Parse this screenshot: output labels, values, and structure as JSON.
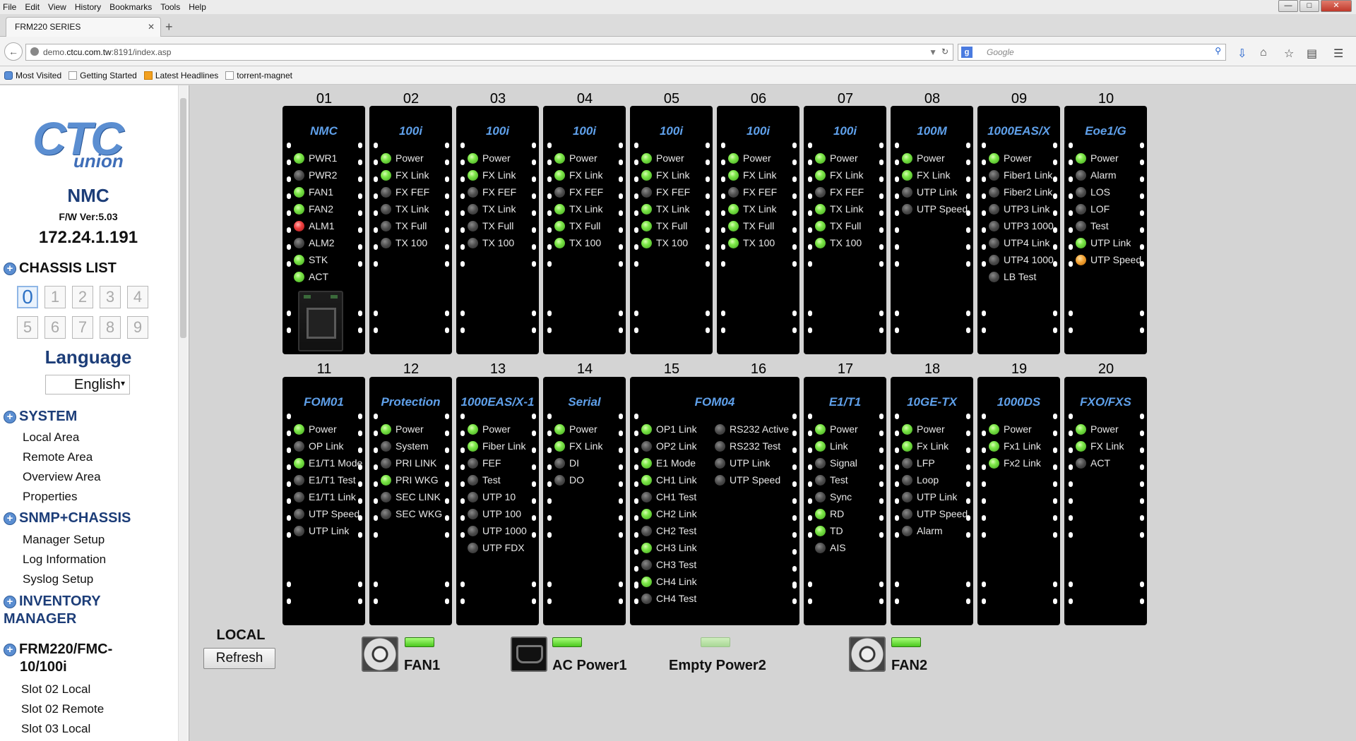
{
  "browser": {
    "menu": [
      "File",
      "Edit",
      "View",
      "History",
      "Bookmarks",
      "Tools",
      "Help"
    ],
    "tab_title": "FRM220 SERIES",
    "url_prefix": "demo.",
    "url_host": "ctcu.com.tw",
    "url_rest": ":8191/index.asp",
    "search_placeholder": "Google",
    "bookmarks": [
      "Most Visited",
      "Getting Started",
      "Latest Headlines",
      "torrent-magnet"
    ]
  },
  "sidebar": {
    "logo_main": "CTC",
    "logo_sub": "union",
    "device": "NMC",
    "firmware": "F/W Ver:5.03",
    "ip": "172.24.1.191",
    "chassis_list_label": "CHASSIS LIST",
    "chassis": [
      "0",
      "1",
      "2",
      "3",
      "4",
      "5",
      "6",
      "7",
      "8",
      "9"
    ],
    "chassis_active": 0,
    "language_label": "Language",
    "language_value": "English",
    "system_label": "SYSTEM",
    "system_items": [
      "Local Area",
      "Remote Area",
      "Overview Area",
      "Properties"
    ],
    "snmp_label": "SNMP+CHASSIS",
    "snmp_items": [
      "Manager Setup",
      "Log Information",
      "Syslog Setup"
    ],
    "inventory_label_1": "INVENTORY",
    "inventory_label_2": "MANAGER",
    "frm_label_1": "FRM220/FMC-",
    "frm_label_2": "10/100i",
    "frm_items": [
      "Slot 02 Local",
      "Slot 02 Remote",
      "Slot 03 Local"
    ]
  },
  "slots": [
    {
      "num": "01",
      "title": "NMC",
      "leds": [
        [
          "PWR1",
          "green"
        ],
        [
          "PWR2",
          "gray"
        ],
        [
          "FAN1",
          "green"
        ],
        [
          "FAN2",
          "green"
        ],
        [
          "ALM1",
          "red"
        ],
        [
          "ALM2",
          "gray"
        ],
        [
          "STK",
          "green"
        ],
        [
          "ACT",
          "green"
        ]
      ]
    },
    {
      "num": "02",
      "title": "100i",
      "leds": [
        [
          "Power",
          "green"
        ],
        [
          "FX Link",
          "green"
        ],
        [
          "FX FEF",
          "gray"
        ],
        [
          "TX Link",
          "gray"
        ],
        [
          "TX Full",
          "gray"
        ],
        [
          "TX 100",
          "gray"
        ]
      ]
    },
    {
      "num": "03",
      "title": "100i",
      "leds": [
        [
          "Power",
          "green"
        ],
        [
          "FX Link",
          "green"
        ],
        [
          "FX FEF",
          "gray"
        ],
        [
          "TX Link",
          "gray"
        ],
        [
          "TX Full",
          "gray"
        ],
        [
          "TX 100",
          "gray"
        ]
      ]
    },
    {
      "num": "04",
      "title": "100i",
      "leds": [
        [
          "Power",
          "green"
        ],
        [
          "FX Link",
          "green"
        ],
        [
          "FX FEF",
          "gray"
        ],
        [
          "TX Link",
          "green"
        ],
        [
          "TX Full",
          "green"
        ],
        [
          "TX 100",
          "green"
        ]
      ]
    },
    {
      "num": "05",
      "title": "100i",
      "leds": [
        [
          "Power",
          "green"
        ],
        [
          "FX Link",
          "green"
        ],
        [
          "FX FEF",
          "gray"
        ],
        [
          "TX Link",
          "green"
        ],
        [
          "TX Full",
          "green"
        ],
        [
          "TX 100",
          "green"
        ]
      ]
    },
    {
      "num": "06",
      "title": "100i",
      "leds": [
        [
          "Power",
          "green"
        ],
        [
          "FX Link",
          "green"
        ],
        [
          "FX FEF",
          "gray"
        ],
        [
          "TX Link",
          "green"
        ],
        [
          "TX Full",
          "green"
        ],
        [
          "TX 100",
          "green"
        ]
      ]
    },
    {
      "num": "07",
      "title": "100i",
      "leds": [
        [
          "Power",
          "green"
        ],
        [
          "FX Link",
          "green"
        ],
        [
          "FX FEF",
          "gray"
        ],
        [
          "TX Link",
          "green"
        ],
        [
          "TX Full",
          "green"
        ],
        [
          "TX 100",
          "green"
        ]
      ]
    },
    {
      "num": "08",
      "title": "100M",
      "leds": [
        [
          "Power",
          "green"
        ],
        [
          "FX Link",
          "green"
        ],
        [
          "UTP Link",
          "gray"
        ],
        [
          "UTP Speed",
          "gray"
        ]
      ]
    },
    {
      "num": "09",
      "title": "1000EAS/X",
      "leds": [
        [
          "Power",
          "green"
        ],
        [
          "Fiber1 Link",
          "gray"
        ],
        [
          "Fiber2 Link",
          "gray"
        ],
        [
          "UTP3 Link",
          "gray"
        ],
        [
          "UTP3 1000",
          "gray"
        ],
        [
          "UTP4 Link",
          "gray"
        ],
        [
          "UTP4 1000",
          "gray"
        ],
        [
          "LB Test",
          "gray"
        ]
      ]
    },
    {
      "num": "10",
      "title": "Eoe1/G",
      "leds": [
        [
          "Power",
          "green"
        ],
        [
          "Alarm",
          "gray"
        ],
        [
          "LOS",
          "gray"
        ],
        [
          "LOF",
          "gray"
        ],
        [
          "Test",
          "gray"
        ],
        [
          "UTP Link",
          "green"
        ],
        [
          "UTP Speed",
          "orange"
        ]
      ]
    },
    {
      "num": "11",
      "title": "FOM01",
      "leds": [
        [
          "Power",
          "green"
        ],
        [
          "OP Link",
          "gray"
        ],
        [
          "E1/T1 Mode",
          "green"
        ],
        [
          "E1/T1 Test",
          "gray"
        ],
        [
          "E1/T1 Link",
          "gray"
        ],
        [
          "UTP Speed",
          "gray"
        ],
        [
          "UTP Link",
          "gray"
        ]
      ]
    },
    {
      "num": "12",
      "title": "Protection",
      "leds": [
        [
          "Power",
          "green"
        ],
        [
          "System",
          "gray"
        ],
        [
          "PRI LINK",
          "gray"
        ],
        [
          "PRI WKG",
          "green"
        ],
        [
          "SEC LINK",
          "gray"
        ],
        [
          "SEC WKG",
          "gray"
        ]
      ]
    },
    {
      "num": "13",
      "title": "1000EAS/X-1",
      "leds": [
        [
          "Power",
          "green"
        ],
        [
          "Fiber Link",
          "green"
        ],
        [
          "FEF",
          "gray"
        ],
        [
          "Test",
          "gray"
        ],
        [
          "UTP 10",
          "gray"
        ],
        [
          "UTP 100",
          "gray"
        ],
        [
          "UTP 1000",
          "gray"
        ],
        [
          "UTP FDX",
          "gray"
        ]
      ]
    },
    {
      "num": "14",
      "title": "Serial",
      "leds": [
        [
          "Power",
          "green"
        ],
        [
          "FX Link",
          "green"
        ],
        [
          "DI",
          "gray"
        ],
        [
          "DO",
          "gray"
        ]
      ]
    },
    {
      "num": "15",
      "num2": "16",
      "title": "FOM04",
      "leds": [
        [
          "OP1 Link",
          "green"
        ],
        [
          "OP2 Link",
          "gray"
        ],
        [
          "E1 Mode",
          "green"
        ],
        [
          "CH1 Link",
          "green"
        ],
        [
          "CH1 Test",
          "gray"
        ],
        [
          "CH2 Link",
          "green"
        ],
        [
          "CH2 Test",
          "gray"
        ],
        [
          "CH3 Link",
          "green"
        ],
        [
          "CH3 Test",
          "gray"
        ],
        [
          "CH4 Link",
          "green"
        ],
        [
          "CH4 Test",
          "gray"
        ]
      ],
      "leds2": [
        [
          "RS232 Active",
          "gray"
        ],
        [
          "RS232 Test",
          "gray"
        ],
        [
          "UTP Link",
          "gray"
        ],
        [
          "UTP Speed",
          "gray"
        ]
      ]
    },
    {
      "num": "17",
      "title": "E1/T1",
      "leds": [
        [
          "Power",
          "green"
        ],
        [
          "Link",
          "green"
        ],
        [
          "Signal",
          "gray"
        ],
        [
          "Test",
          "gray"
        ],
        [
          "Sync",
          "gray"
        ],
        [
          "RD",
          "green"
        ],
        [
          "TD",
          "green"
        ],
        [
          "AIS",
          "gray"
        ]
      ]
    },
    {
      "num": "18",
      "title": "10GE-TX",
      "leds": [
        [
          "Power",
          "green"
        ],
        [
          "Fx Link",
          "green"
        ],
        [
          "LFP",
          "gray"
        ],
        [
          "Loop",
          "gray"
        ],
        [
          "UTP Link",
          "gray"
        ],
        [
          "UTP Speed",
          "gray"
        ],
        [
          "Alarm",
          "gray"
        ]
      ]
    },
    {
      "num": "19",
      "title": "1000DS",
      "leds": [
        [
          "Power",
          "green"
        ],
        [
          "Fx1 Link",
          "green"
        ],
        [
          "Fx2 Link",
          "green"
        ]
      ]
    },
    {
      "num": "20",
      "title": "FXO/FXS",
      "leds": [
        [
          "Power",
          "green"
        ],
        [
          "FX Link",
          "green"
        ],
        [
          "ACT",
          "gray"
        ]
      ]
    }
  ],
  "footer": {
    "local_label": "LOCAL",
    "refresh_label": "Refresh",
    "psu": [
      {
        "label": "FAN1",
        "icon": "fan-icon",
        "status": "on"
      },
      {
        "label": "AC Power1",
        "icon": "ac-plug-icon",
        "status": "on"
      },
      {
        "label": "Empty Power2",
        "icon": "none",
        "status": "off"
      },
      {
        "label": "FAN2",
        "icon": "fan-icon",
        "status": "on"
      }
    ]
  }
}
